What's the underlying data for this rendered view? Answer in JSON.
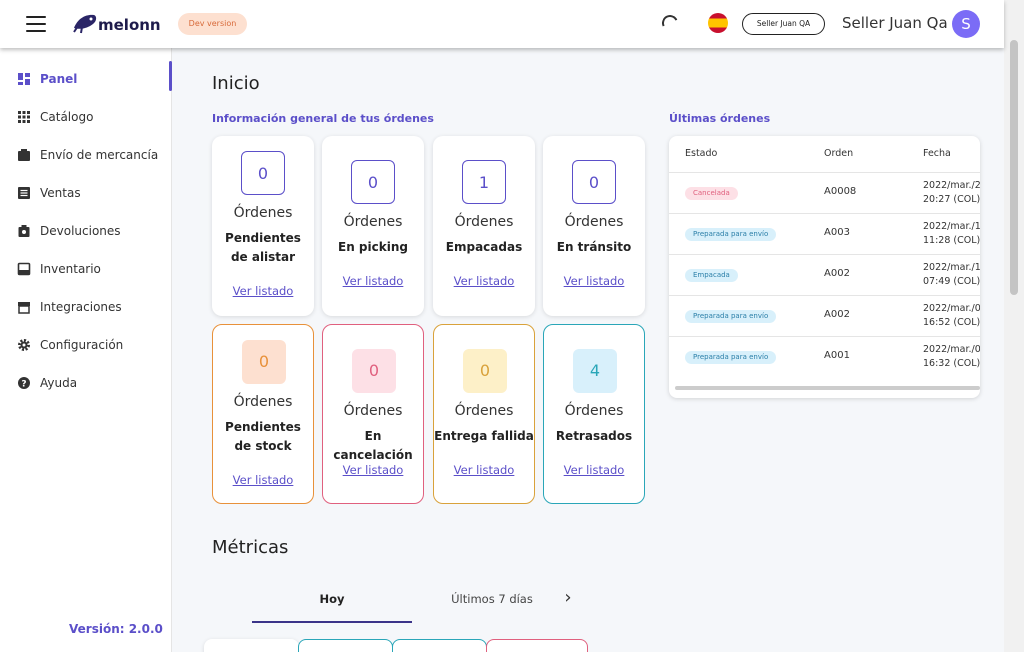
{
  "header": {
    "brand": "melonn",
    "dev_badge": "Dev version",
    "seller_pill": "Seller Juan QA",
    "seller_name": "Seller Juan Qa",
    "avatar_initial": "S"
  },
  "sidebar": {
    "items": [
      {
        "label": "Panel",
        "icon": "dashboard-icon",
        "active": true
      },
      {
        "label": "Catálogo",
        "icon": "grid-icon"
      },
      {
        "label": "Envío de mercancía",
        "icon": "truck-icon"
      },
      {
        "label": "Ventas",
        "icon": "list-icon"
      },
      {
        "label": "Devoluciones",
        "icon": "return-box-icon"
      },
      {
        "label": "Inventario",
        "icon": "inventory-icon"
      },
      {
        "label": "Integraciones",
        "icon": "store-icon"
      },
      {
        "label": "Configuración",
        "icon": "gear-icon"
      },
      {
        "label": "Ayuda",
        "icon": "help-icon"
      }
    ],
    "version": "Versión: 2.0.0"
  },
  "main": {
    "title": "Inicio",
    "orders_title": "Información general de tus órdenes",
    "order_cards": [
      {
        "count": "0",
        "label": "Órdenes",
        "status": "Pendientes de alistar",
        "link": "Ver listado"
      },
      {
        "count": "0",
        "label": "Órdenes",
        "status": "En picking",
        "link": "Ver listado"
      },
      {
        "count": "1",
        "label": "Órdenes",
        "status": "Empacadas",
        "link": "Ver listado"
      },
      {
        "count": "0",
        "label": "Órdenes",
        "status": "En tránsito",
        "link": "Ver listado"
      },
      {
        "count": "0",
        "label": "Órdenes",
        "status": "Pendientes de stock",
        "link": "Ver listado",
        "color": "#e8913a",
        "bg": "#fde0d0"
      },
      {
        "count": "0",
        "label": "Órdenes",
        "status": "En cancelación",
        "link": "Ver listado",
        "color": "#e0607e",
        "bg": "#fde0e6"
      },
      {
        "count": "0",
        "label": "Órdenes",
        "status": "Entrega fallida",
        "link": "Ver listado",
        "color": "#d9a23b",
        "bg": "#fdf0c8"
      },
      {
        "count": "4",
        "label": "Órdenes",
        "status": "Retrasados",
        "link": "Ver listado",
        "color": "#2aa6b8",
        "bg": "#d8f0fb"
      }
    ],
    "latest_title": "Últimas órdenes",
    "latest_table": {
      "headers": [
        "Estado",
        "Orden",
        "Fecha"
      ],
      "rows": [
        {
          "estado": "Cancelada",
          "estado_color": "#e0607e",
          "estado_bg": "#fde0e6",
          "orden": "A0008",
          "fecha1": "2022/mar./2",
          "fecha2": "20:27 (COL)"
        },
        {
          "estado": "Preparada para envío",
          "estado_color": "#2b7fa8",
          "estado_bg": "#d8f0fb",
          "orden": "A003",
          "fecha1": "2022/mar./1",
          "fecha2": "11:28 (COL)"
        },
        {
          "estado": "Empacada",
          "estado_color": "#2b7fa8",
          "estado_bg": "#d8f0fb",
          "orden": "A002",
          "fecha1": "2022/mar./1",
          "fecha2": "07:49 (COL)"
        },
        {
          "estado": "Preparada para envío",
          "estado_color": "#2b7fa8",
          "estado_bg": "#d8f0fb",
          "orden": "A002",
          "fecha1": "2022/mar./0",
          "fecha2": "16:52 (COL)"
        },
        {
          "estado": "Preparada para envío",
          "estado_color": "#2b7fa8",
          "estado_bg": "#d8f0fb",
          "orden": "A001",
          "fecha1": "2022/mar./0",
          "fecha2": "16:32 (COL)"
        }
      ]
    },
    "metrics_title": "Métricas",
    "metric_tabs": [
      {
        "label": "Hoy",
        "active": true
      },
      {
        "label": "Últimos 7 días"
      }
    ],
    "next_arrow": "›"
  },
  "colors": {
    "accent": "#5b4fc9",
    "card_outline": "#5b4fc9"
  }
}
